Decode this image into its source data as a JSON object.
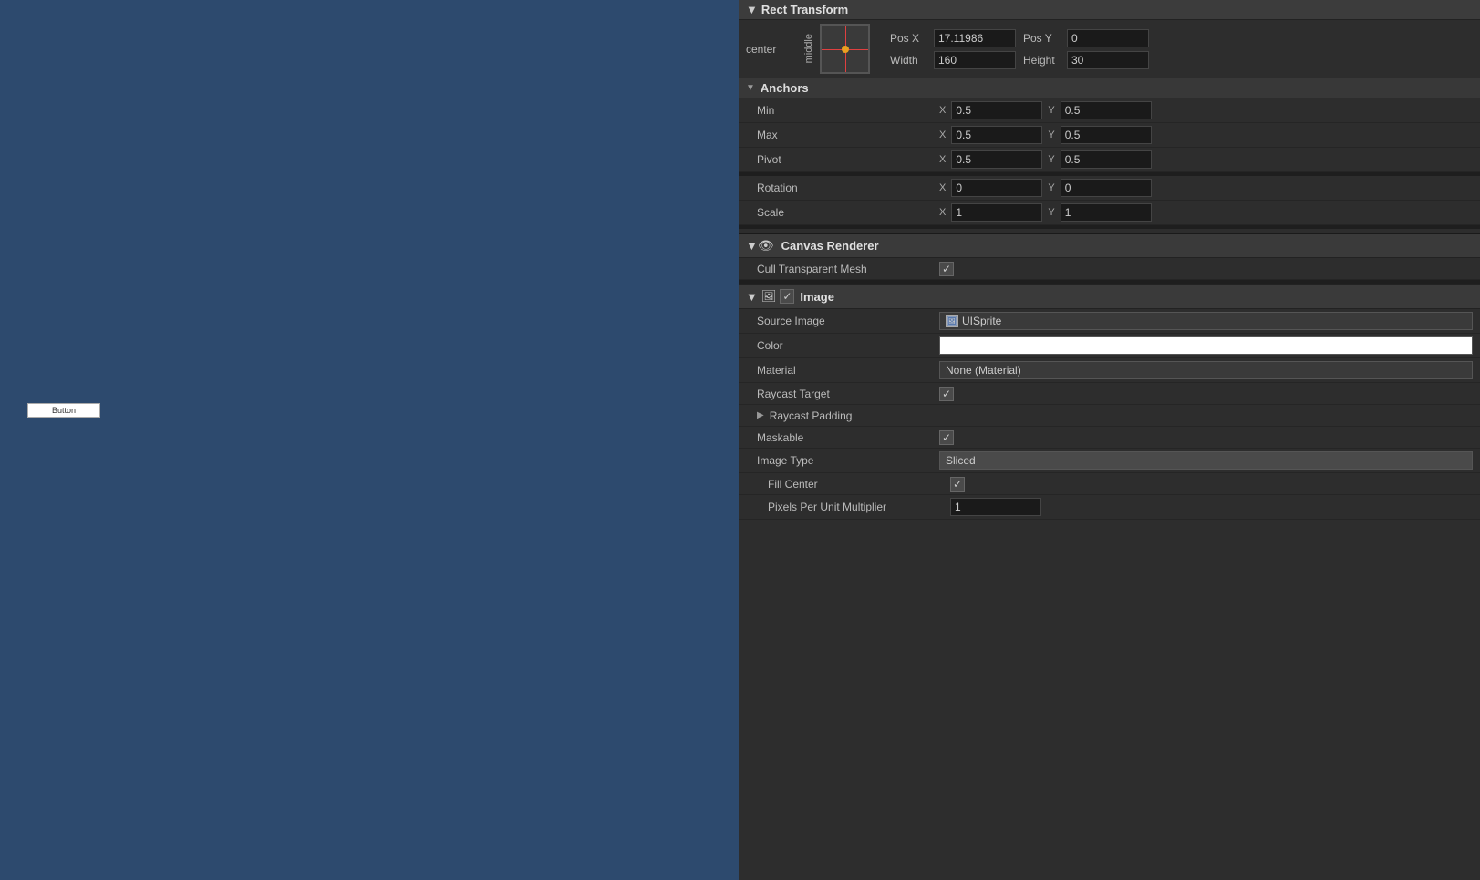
{
  "sceneView": {
    "bgColor": "#2d4a6e",
    "buttonLabel": "Button"
  },
  "inspector": {
    "rectTransform": {
      "headerTitle": "Rect Transform",
      "anchorPreset": "center",
      "middleLabel": "middle",
      "posX": {
        "label": "Pos X",
        "value": "17.11986"
      },
      "posY": {
        "label": "Pos Y",
        "value": "0"
      },
      "width": {
        "label": "Width",
        "value": "160"
      },
      "height": {
        "label": "Height",
        "value": "30"
      },
      "anchors": {
        "sectionLabel": "Anchors",
        "min": {
          "label": "Min",
          "xLabel": "X",
          "xValue": "0.5",
          "yLabel": "Y",
          "yValue": "0.5"
        },
        "max": {
          "label": "Max",
          "xLabel": "X",
          "xValue": "0.5",
          "yLabel": "Y",
          "yValue": "0.5"
        }
      },
      "pivot": {
        "label": "Pivot",
        "xLabel": "X",
        "xValue": "0.5",
        "yLabel": "Y",
        "yValue": "0.5"
      },
      "rotation": {
        "label": "Rotation",
        "xLabel": "X",
        "xValue": "0",
        "yLabel": "Y",
        "yValue": "0"
      },
      "scale": {
        "label": "Scale",
        "xLabel": "X",
        "xValue": "1",
        "yLabel": "Y",
        "yValue": "1"
      }
    },
    "canvasRenderer": {
      "title": "Canvas Renderer",
      "cullTransparentMesh": {
        "label": "Cull Transparent Mesh",
        "checked": true
      }
    },
    "image": {
      "title": "Image",
      "checked": true,
      "sourceImage": {
        "label": "Source Image",
        "spriteIcon": "🖼",
        "value": "UISprite"
      },
      "color": {
        "label": "Color"
      },
      "material": {
        "label": "Material",
        "value": "None (Material)"
      },
      "raycastTarget": {
        "label": "Raycast Target",
        "checked": true
      },
      "raycastPadding": {
        "label": "Raycast Padding"
      },
      "maskable": {
        "label": "Maskable",
        "checked": true
      },
      "imageType": {
        "label": "Image Type",
        "value": "Sliced"
      },
      "fillCenter": {
        "label": "Fill Center",
        "checked": true
      },
      "pixelsPerUnitMultiplier": {
        "label": "Pixels Per Unit Multiplier",
        "value": "1"
      }
    }
  }
}
